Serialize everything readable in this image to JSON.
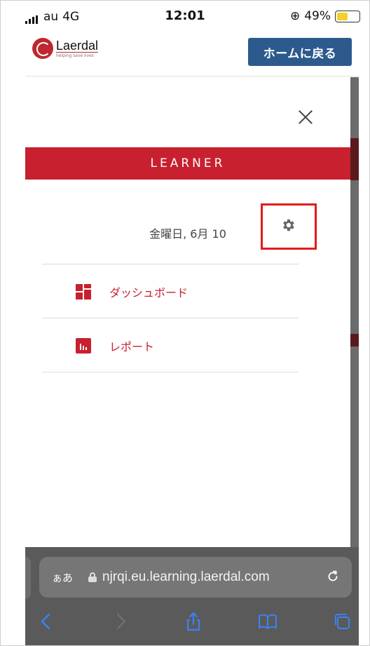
{
  "status_bar": {
    "carrier": "au",
    "network": "4G",
    "time": "12:01",
    "battery_text": "49%",
    "battery_level": 0.49
  },
  "header": {
    "logo_name": "Laerdal",
    "logo_tagline": "helping save lives",
    "home_button_label": "ホームに戻る"
  },
  "panel": {
    "role_label": "LEARNER",
    "date": "金曜日, 6月 10",
    "menu": [
      {
        "label": "ダッシュボード",
        "icon": "dashboard-icon"
      },
      {
        "label": "レポート",
        "icon": "report-icon"
      }
    ]
  },
  "browser": {
    "text_size_label": "ぁあ",
    "url": "njrqi.eu.learning.laerdal.com"
  },
  "colors": {
    "accent_red": "#c8202f",
    "home_button_blue": "#2c5a8c",
    "highlight_box": "#e01c1c",
    "safari_icon_blue": "#3a82f7"
  }
}
